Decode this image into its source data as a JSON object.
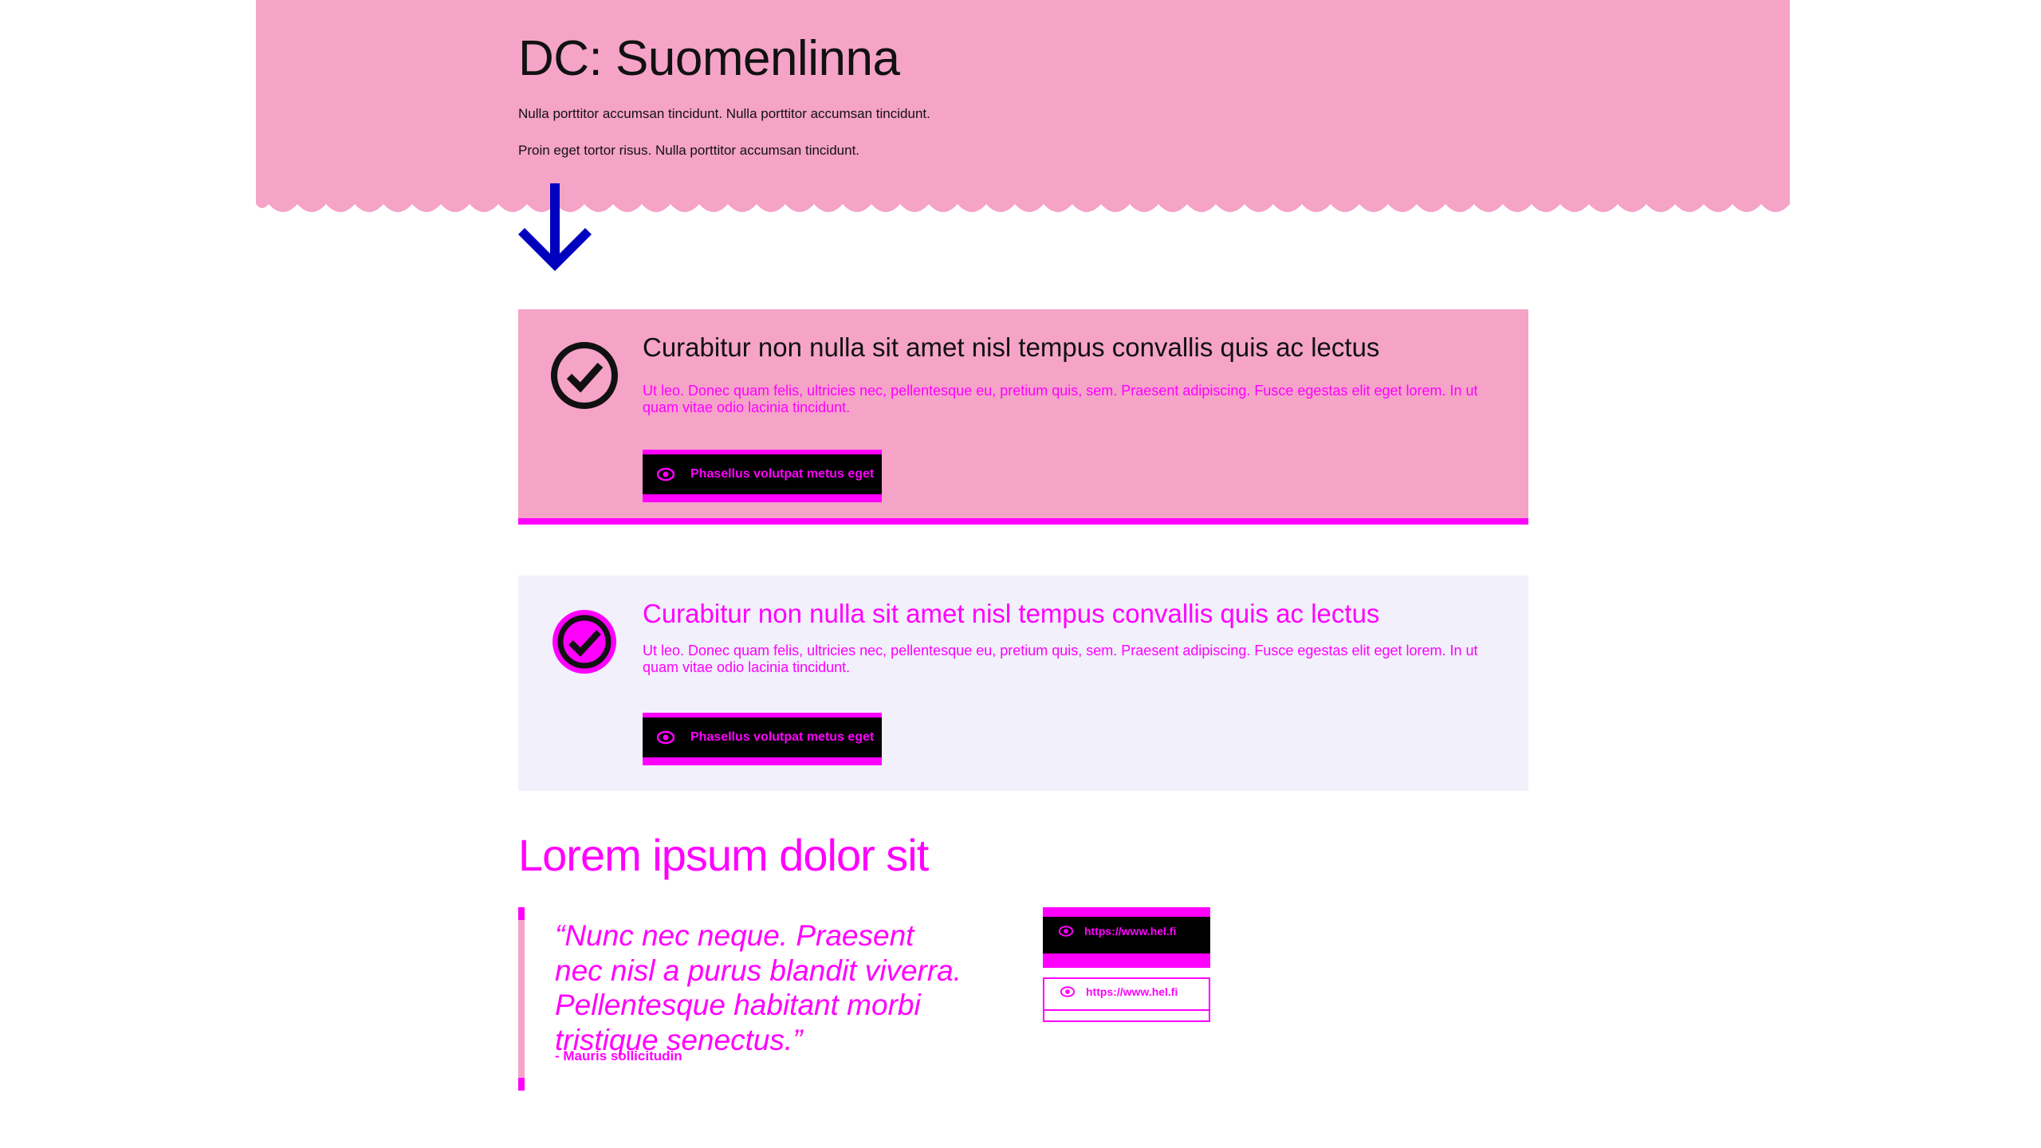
{
  "hero": {
    "title": "DC: Suomenlinna",
    "paragraphs": [
      "Nulla porttitor accumsan tincidunt. Nulla porttitor accumsan tincidunt.",
      "Proin eget tortor risus. Nulla porttitor accumsan tincidunt."
    ]
  },
  "notices": [
    {
      "title": "Curabitur non nulla sit amet nisl tempus convallis quis ac lectus",
      "text": "Ut leo. Donec quam felis, ultricies nec, pellentesque eu, pretium quis, sem. Praesent adipiscing. Fusce egestas elit eget lorem. In ut quam vitae odio lacinia tincidunt.",
      "button_label": "Phasellus volutpat metus eget"
    },
    {
      "title": "Curabitur non nulla sit amet nisl tempus convallis quis ac lectus",
      "text": "Ut leo. Donec quam felis, ultricies nec, pellentesque eu, pretium quis, sem. Praesent adipiscing. Fusce egestas elit eget lorem. In ut quam vitae odio lacinia tincidunt.",
      "button_label": "Phasellus volutpat metus eget"
    }
  ],
  "section": {
    "heading": "Lorem ipsum dolor sit"
  },
  "quote": {
    "text": "“Nunc nec neque. Praesent nec nisl a purus blandit viverra. Pellentesque habitant morbi tristique senectus.”",
    "author": "- Mauris sollicitudin"
  },
  "links": {
    "primary_label": "https://www.hel.fi",
    "secondary_label": "https://www.hel.fi"
  },
  "colors": {
    "pink": "#f5a3c7",
    "magenta": "#ff00ff",
    "lavender": "#f1f0fb",
    "arrow": "#0000bf"
  },
  "icons": [
    "arrow-down-icon",
    "check-circle-icon",
    "eye-icon"
  ]
}
